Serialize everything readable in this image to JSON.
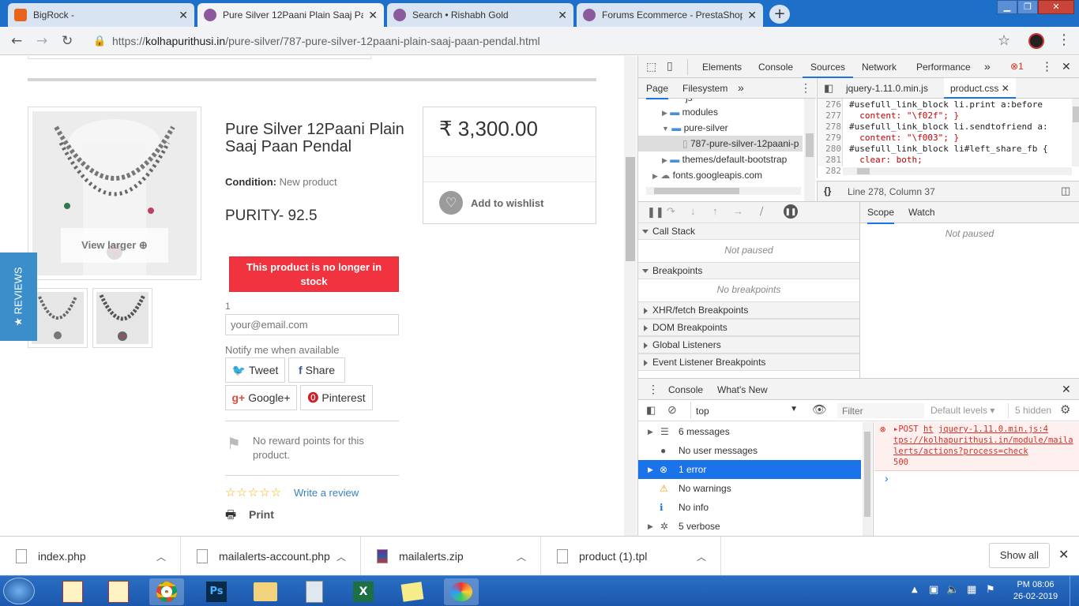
{
  "browser": {
    "tabs": [
      {
        "title": "BigRock -",
        "active": false
      },
      {
        "title": "Pure Silver 12Paani Plain Saaj Pa",
        "active": true
      },
      {
        "title": "Search • Rishabh Gold",
        "active": false
      },
      {
        "title": "Forums Ecommerce - PrestaShop",
        "active": false
      }
    ],
    "url_prefix": "https://",
    "url_host": "kolhapurithusi.in",
    "url_path": "/pure-silver/787-pure-silver-12paani-plain-saaj-paan-pendal.html"
  },
  "product": {
    "view_larger": "View larger",
    "title": "Pure Silver 12Paani Plain Saaj Paan Pendal",
    "condition_label": "Condition:",
    "condition_value": "New product",
    "purity": "PURITY- 92.5",
    "out_of_stock": "This product is no longer in stock",
    "qty": "1",
    "email_placeholder": "your@email.com",
    "notify": "Notify me when available",
    "tweet": "Tweet",
    "share": "Share",
    "googleplus": "Google+",
    "pinterest": "Pinterest",
    "reward": "No reward points for this product.",
    "write_review": "Write a review",
    "print": "Print",
    "price": "₹ 3,300.00",
    "wishlist": "Add to wishlist",
    "reviews_tab": "★ REVIEWS"
  },
  "devtools": {
    "main_tabs": [
      "Elements",
      "Console",
      "Sources",
      "Network",
      "Performance"
    ],
    "active_tab": "Sources",
    "more": "»",
    "error_count": "1",
    "nav_tabs": [
      "Page",
      "Filesystem"
    ],
    "tree": [
      {
        "label": "js",
        "indent": 3
      },
      {
        "label": "modules",
        "indent": 2
      },
      {
        "label": "pure-silver",
        "indent": 2
      },
      {
        "label": "787-pure-silver-12paani-p",
        "indent": 3
      },
      {
        "label": "themes/default-bootstrap",
        "indent": 2
      },
      {
        "label": "fonts.googleapis.com",
        "indent": 1
      }
    ],
    "file_tabs": [
      "jquery-1.11.0.min.js",
      "product.css"
    ],
    "code": [
      {
        "ln": "276",
        "text": "#usefull_link_block li.print a:before"
      },
      {
        "ln": "277",
        "text": "  content: \"\\f02f\"; }"
      },
      {
        "ln": "278",
        "text": "#usefull_link_block li.sendtofriend a:"
      },
      {
        "ln": "279",
        "text": "  content: \"\\f003\"; }"
      },
      {
        "ln": "280",
        "text": "#usefull_link_block li#left_share_fb {"
      },
      {
        "ln": "281",
        "text": "  clear: both;"
      },
      {
        "ln": "282",
        "text": ""
      }
    ],
    "cursor_pos": "Line 278, Column 37",
    "braces": "{}",
    "scope_tabs": [
      "Scope",
      "Watch"
    ],
    "not_paused": "Not paused",
    "call_stack": "Call Stack",
    "call_stack_status": "Not paused",
    "breakpoints": "Breakpoints",
    "no_breakpoints": "No breakpoints",
    "xhr": "XHR/fetch Breakpoints",
    "dom": "DOM Breakpoints",
    "global": "Global Listeners",
    "event": "Event Listener Breakpoints",
    "drawer_tabs": [
      "Console",
      "What's New"
    ],
    "context": "top",
    "filter_placeholder": "Filter",
    "levels": "Default levels ▾",
    "hidden": "5 hidden",
    "console_groups": [
      {
        "label": "6 messages",
        "selected": false
      },
      {
        "label": "No user messages",
        "selected": false
      },
      {
        "label": "1 error",
        "selected": true
      },
      {
        "label": "No warnings",
        "selected": false
      },
      {
        "label": "No info",
        "selected": false
      },
      {
        "label": "5 verbose",
        "selected": false
      }
    ],
    "err_method": "▸POST",
    "err_ht": "ht",
    "err_src": "jquery-1.11.0.min.js:4",
    "err_url": "tps://kolhapurithusi.in/module/mailalerts/actions?process=check",
    "err_code": "500",
    "prompt": "›"
  },
  "downloads": {
    "items": [
      "index.php",
      "mailalerts-account.php",
      "mailalerts.zip",
      "product (1).tpl"
    ],
    "show_all": "Show all"
  },
  "taskbar": {
    "time": "PM 08:06",
    "date": "26-02-2019"
  },
  "colors": {
    "accent": "#1a73e8",
    "oos": "#f13340",
    "error_bg": "#fff0f0",
    "error_red": "#d93025",
    "selected_row": "#1a73e8"
  }
}
